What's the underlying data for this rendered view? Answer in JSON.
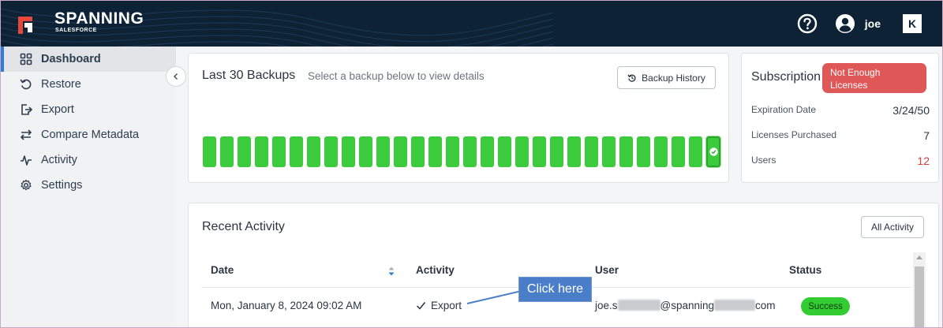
{
  "brand": {
    "name": "SPANNING",
    "sub": "SALESFORCE"
  },
  "header": {
    "username": "joe",
    "partner_logo": "K"
  },
  "sidebar": {
    "items": [
      {
        "label": "Dashboard",
        "icon": "grid-icon",
        "active": true
      },
      {
        "label": "Restore",
        "icon": "restore-icon"
      },
      {
        "label": "Export",
        "icon": "export-icon"
      },
      {
        "label": "Compare Metadata",
        "icon": "compare-icon"
      },
      {
        "label": "Activity",
        "icon": "activity-icon"
      },
      {
        "label": "Settings",
        "icon": "gear-icon"
      }
    ]
  },
  "backups": {
    "title": "Last 30 Backups",
    "subtitle": "Select a backup below to view details",
    "history_button": "Backup History",
    "count": 30,
    "selected_index": 29,
    "bar_color": "#3ccb3c"
  },
  "subscription": {
    "title": "Subscription",
    "alert": "Not Enough Licenses",
    "expiration_label": "Expiration Date",
    "expiration_value": "3/24/50",
    "licenses_label": "Licenses Purchased",
    "licenses_value": "7",
    "users_label": "Users",
    "users_value": "12"
  },
  "activity": {
    "title": "Recent Activity",
    "all_button": "All Activity",
    "columns": {
      "date": "Date",
      "activity": "Activity",
      "user": "User",
      "status": "Status"
    },
    "rows": [
      {
        "date": "Mon, January 8, 2024 09:02 AM",
        "activity": "Export",
        "user_prefix": "joe.s",
        "user_middle": "@spanning",
        "user_suffix": "com",
        "status": "Success"
      }
    ]
  },
  "callout": {
    "text": "Click here"
  },
  "colors": {
    "topbar": "#0d2235",
    "accent": "#2f7bd8",
    "success": "#33cc33",
    "alert": "#e05757",
    "callout": "#4b7ec9"
  }
}
